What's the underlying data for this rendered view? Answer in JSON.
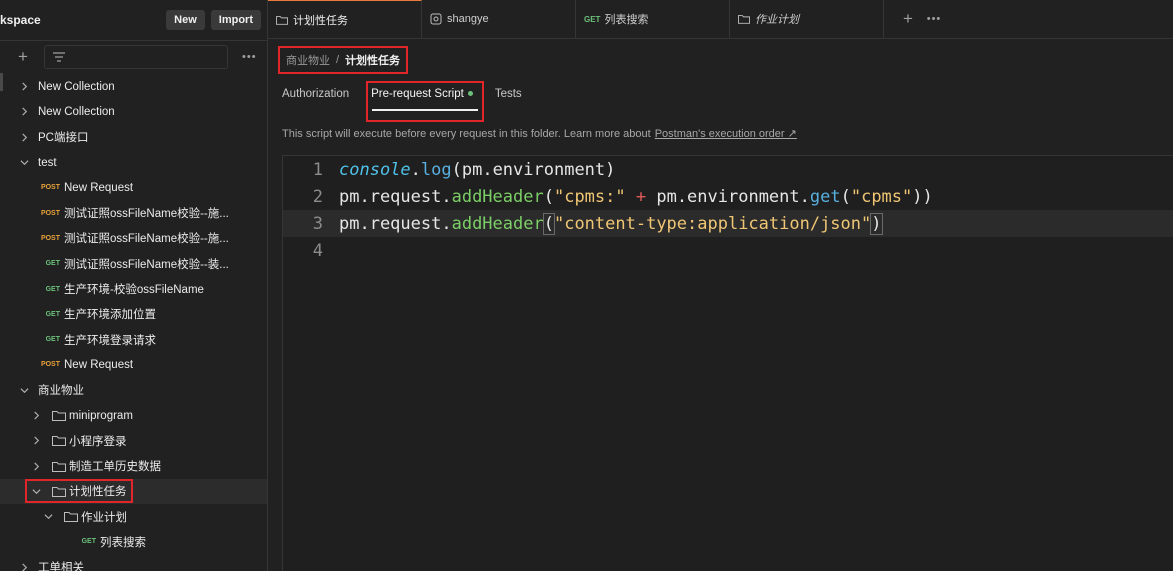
{
  "sidebar": {
    "title": "kspace",
    "new_label": "New",
    "import_label": "Import",
    "more_label": "•••",
    "tree": [
      {
        "indent": 0,
        "chev": "right",
        "label": "New Collection"
      },
      {
        "indent": 0,
        "chev": "right",
        "label": "New Collection"
      },
      {
        "indent": 0,
        "chev": "right",
        "label": "PC端接口"
      },
      {
        "indent": 0,
        "chev": "down",
        "label": "test"
      },
      {
        "indent": 1,
        "method": "POST",
        "label": "New Request"
      },
      {
        "indent": 1,
        "method": "POST",
        "label": "测试证照ossFileName校验--施..."
      },
      {
        "indent": 1,
        "method": "POST",
        "label": "测试证照ossFileName校验--施..."
      },
      {
        "indent": 1,
        "method": "GET",
        "label": "测试证照ossFileName校验--装..."
      },
      {
        "indent": 1,
        "method": "GET",
        "label": "生产环境-校验ossFileName"
      },
      {
        "indent": 1,
        "method": "GET",
        "label": "生产环境添加位置"
      },
      {
        "indent": 1,
        "method": "GET",
        "label": "生产环境登录请求"
      },
      {
        "indent": 1,
        "method": "POST",
        "label": "New Request"
      },
      {
        "indent": 0,
        "chev": "down",
        "label": "商业物业"
      },
      {
        "indent": 1,
        "chev": "right",
        "folder": true,
        "label": "miniprogram"
      },
      {
        "indent": 1,
        "chev": "right",
        "folder": true,
        "label": "小程序登录"
      },
      {
        "indent": 1,
        "chev": "right",
        "folder": true,
        "label": "制造工单历史数据"
      },
      {
        "indent": 1,
        "chev": "down",
        "folder": true,
        "label": "计划性任务",
        "selected": true
      },
      {
        "indent": 2,
        "chev": "down",
        "folder": true,
        "label": "作业计划"
      },
      {
        "indent": 3,
        "method": "GET",
        "label": "列表搜索"
      },
      {
        "indent": 0,
        "chev": "right",
        "label": "工单相关"
      }
    ]
  },
  "tabs": [
    {
      "label": "计划性任务",
      "icon": "folder-icon",
      "active": true
    },
    {
      "label": "shangye",
      "icon": "environment-icon"
    },
    {
      "label": "列表搜索",
      "method": "GET"
    },
    {
      "label": "作业计划",
      "icon": "folder-icon",
      "italic": true
    }
  ],
  "tab_more": "•••",
  "breadcrumb": {
    "parent": "商业物业",
    "sep": "/",
    "current": "计划性任务"
  },
  "subtabs": {
    "authorization": "Authorization",
    "prerequest": "Pre-request Script",
    "tests": "Tests"
  },
  "description": {
    "text": "This script will execute before every request in this folder. Learn more about",
    "link": "Postman's execution order ↗"
  },
  "editor": {
    "line_numbers": [
      "1",
      "2",
      "3",
      "4"
    ],
    "l1": {
      "obj": "console",
      "dot": ".",
      "fn": "log",
      "rest": "(pm.environment)"
    },
    "l2": {
      "a": "pm.request.",
      "fn": "addHeader",
      "p1": "(",
      "s1": "\"cpms:\"",
      "op": " + ",
      "b": "pm.environment.",
      "fn2": "get",
      "p2": "(",
      "s2": "\"cpms\"",
      "p3": "))"
    },
    "l3": {
      "a": "pm.request.",
      "fn": "addHeader",
      "p1": "(",
      "s1": "\"content-type:application/json\"",
      "p2": ")"
    }
  },
  "colors": {
    "accent": "#e87b3c",
    "highlight_box": "#e0262a",
    "post": "#e8a33b",
    "get": "#6bc17a"
  }
}
